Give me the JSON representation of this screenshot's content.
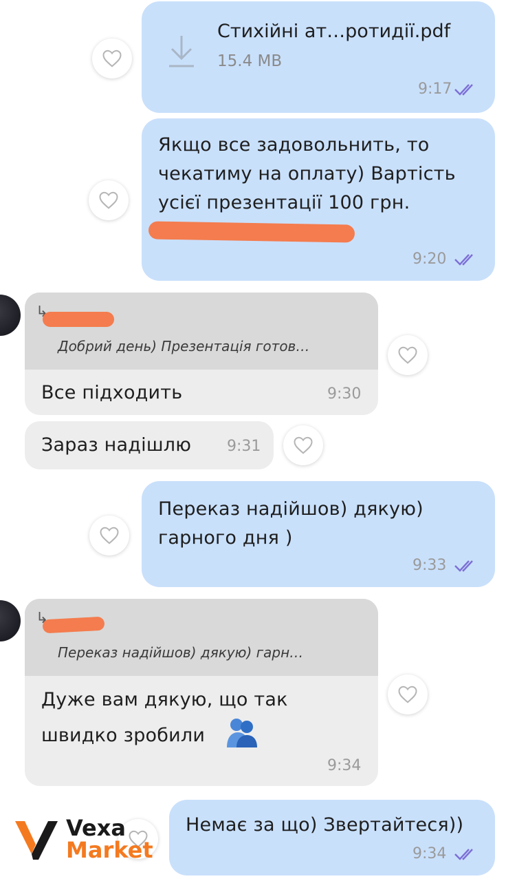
{
  "messages": {
    "m1": {
      "file_name": "Стихійні ат…ротидії.pdf",
      "file_size": "15.4 MB",
      "time": "9:17"
    },
    "m2": {
      "line1": "Якщо все задовольнить, то",
      "line2": "чекатиму на  оплату) Вартість",
      "line3": "усієї презентації 100 грн.",
      "time": "9:20"
    },
    "m3": {
      "quote_text": "Добрий день) Презентація готов…",
      "text": "Все підходить",
      "time": "9:30"
    },
    "m4": {
      "text": "Зараз надішлю",
      "time": "9:31"
    },
    "m5": {
      "line1": "Переказ надійшов) дякую)",
      "line2": "гарного дня )",
      "time": "9:33"
    },
    "m6": {
      "quote_text": "Переказ надійшов) дякую) гарн…",
      "line1": "Дуже вам дякую, що так",
      "line2": "швидко зробили",
      "time": "9:34"
    },
    "m7": {
      "text": "Немає за що) Звертайтеся))",
      "time": "9:34"
    }
  },
  "icons": {
    "download": "download-icon",
    "like": "heart-outline-icon",
    "read": "double-check-icon",
    "reply": "reply-arrow-icon",
    "emoji": "people-hugging-emoji"
  },
  "logo": {
    "word1": "Vexa",
    "word2": "Market"
  },
  "colors": {
    "outgoing_bubble": "#c9e0fb",
    "incoming_bubble": "#ededed",
    "quote_bg": "#d9d9d9",
    "redaction": "#f47c4e",
    "read_ticks": "#7c6fd6",
    "logo_dark": "#1a1a1a",
    "logo_orange": "#f47a20"
  }
}
